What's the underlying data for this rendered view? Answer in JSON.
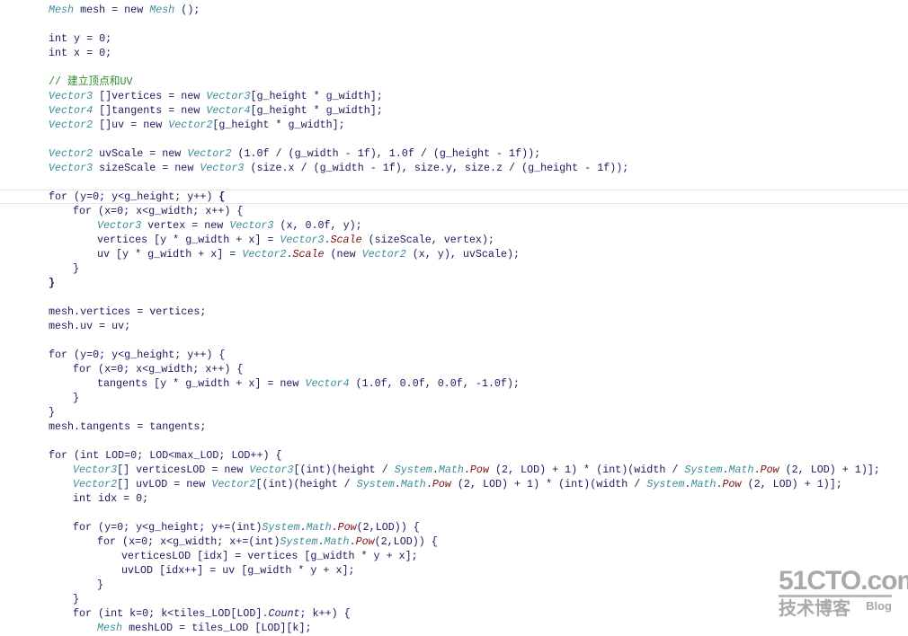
{
  "code": {
    "current_line": 13,
    "lines": [
      [
        [
          "t",
          "Mesh"
        ],
        [
          "k",
          " mesh = new "
        ],
        [
          "t",
          "Mesh"
        ],
        [
          "k",
          " ();"
        ]
      ],
      [],
      [
        [
          "k",
          "int y = 0;"
        ]
      ],
      [
        [
          "k",
          "int x = 0;"
        ]
      ],
      [],
      [
        [
          "c",
          "// 建立顶点和UV"
        ]
      ],
      [
        [
          "t",
          "Vector3"
        ],
        [
          "k",
          " []vertices = new "
        ],
        [
          "t",
          "Vector3"
        ],
        [
          "k",
          "[g_height * g_width];"
        ]
      ],
      [
        [
          "t",
          "Vector4"
        ],
        [
          "k",
          " []tangents = new "
        ],
        [
          "t",
          "Vector4"
        ],
        [
          "k",
          "[g_height * g_width];"
        ]
      ],
      [
        [
          "t",
          "Vector2"
        ],
        [
          "k",
          " []uv = new "
        ],
        [
          "t",
          "Vector2"
        ],
        [
          "k",
          "[g_height * g_width];"
        ]
      ],
      [],
      [
        [
          "t",
          "Vector2"
        ],
        [
          "k",
          " uvScale = new "
        ],
        [
          "t",
          "Vector2"
        ],
        [
          "k",
          " (1.0f / (g_width - 1f), 1.0f / (g_height - 1f));"
        ]
      ],
      [
        [
          "t",
          "Vector3"
        ],
        [
          "k",
          " sizeScale = new "
        ],
        [
          "t",
          "Vector3"
        ],
        [
          "k",
          " (size.x / (g_width - 1f), size.y, size.z / (g_height - 1f));"
        ]
      ],
      [],
      [
        [
          "k",
          "for (y=0; y<g_height; y++) "
        ],
        [
          "b",
          "{"
        ]
      ],
      [
        [
          "k",
          "\tfor (x=0; x<g_width; x++) {"
        ]
      ],
      [
        [
          "k",
          "\t\t"
        ],
        [
          "t",
          "Vector3"
        ],
        [
          "k",
          " vertex = new "
        ],
        [
          "t",
          "Vector3"
        ],
        [
          "k",
          " (x, 0.0f, y);"
        ]
      ],
      [
        [
          "k",
          "\t\tvertices [y * g_width + x] = "
        ],
        [
          "t",
          "Vector3"
        ],
        [
          "k",
          "."
        ],
        [
          "m",
          "Scale"
        ],
        [
          "k",
          " (sizeScale, vertex);"
        ]
      ],
      [
        [
          "k",
          "\t\tuv [y * g_width + x] = "
        ],
        [
          "t",
          "Vector2"
        ],
        [
          "k",
          "."
        ],
        [
          "m",
          "Scale"
        ],
        [
          "k",
          " (new "
        ],
        [
          "t",
          "Vector2"
        ],
        [
          "k",
          " (x, y), uvScale);"
        ]
      ],
      [
        [
          "k",
          "\t}"
        ]
      ],
      [
        [
          "b",
          "}"
        ]
      ],
      [],
      [
        [
          "k",
          "mesh.vertices = vertices;"
        ]
      ],
      [
        [
          "k",
          "mesh.uv = uv;"
        ]
      ],
      [],
      [
        [
          "k",
          "for (y=0; y<g_height; y++) {"
        ]
      ],
      [
        [
          "k",
          "\tfor (x=0; x<g_width; x++) {"
        ]
      ],
      [
        [
          "k",
          "\t\ttangents [y * g_width + x] = new "
        ],
        [
          "t",
          "Vector4"
        ],
        [
          "k",
          " (1.0f, 0.0f, 0.0f, -1.0f);"
        ]
      ],
      [
        [
          "k",
          "\t}"
        ]
      ],
      [
        [
          "k",
          "}"
        ]
      ],
      [
        [
          "k",
          "mesh.tangents = tangents;"
        ]
      ],
      [],
      [
        [
          "k",
          "for (int LOD=0; LOD<max_LOD; LOD++) {"
        ]
      ],
      [
        [
          "k",
          "\t"
        ],
        [
          "t",
          "Vector3"
        ],
        [
          "k",
          "[] verticesLOD = new "
        ],
        [
          "t",
          "Vector3"
        ],
        [
          "k",
          "[(int)(height / "
        ],
        [
          "t",
          "System"
        ],
        [
          "k",
          "."
        ],
        [
          "t",
          "Math"
        ],
        [
          "k",
          "."
        ],
        [
          "m",
          "Pow"
        ],
        [
          "k",
          " (2, LOD) + 1) * (int)(width / "
        ],
        [
          "t",
          "System"
        ],
        [
          "k",
          "."
        ],
        [
          "t",
          "Math"
        ],
        [
          "k",
          "."
        ],
        [
          "m",
          "Pow"
        ],
        [
          "k",
          " (2, LOD) + 1)];"
        ]
      ],
      [
        [
          "k",
          "\t"
        ],
        [
          "t",
          "Vector2"
        ],
        [
          "k",
          "[] uvLOD = new "
        ],
        [
          "t",
          "Vector2"
        ],
        [
          "k",
          "[(int)(height / "
        ],
        [
          "t",
          "System"
        ],
        [
          "k",
          "."
        ],
        [
          "t",
          "Math"
        ],
        [
          "k",
          "."
        ],
        [
          "m",
          "Pow"
        ],
        [
          "k",
          " (2, LOD) + 1) * (int)(width / "
        ],
        [
          "t",
          "System"
        ],
        [
          "k",
          "."
        ],
        [
          "t",
          "Math"
        ],
        [
          "k",
          "."
        ],
        [
          "m",
          "Pow"
        ],
        [
          "k",
          " (2, LOD) + 1)];"
        ]
      ],
      [
        [
          "k",
          "\tint idx = 0;"
        ]
      ],
      [],
      [
        [
          "k",
          "\tfor (y=0; y<g_height; y+=(int)"
        ],
        [
          "t",
          "System"
        ],
        [
          "k",
          "."
        ],
        [
          "t",
          "Math"
        ],
        [
          "k",
          "."
        ],
        [
          "m",
          "Pow"
        ],
        [
          "k",
          "(2,LOD)) {"
        ]
      ],
      [
        [
          "k",
          "\t\tfor (x=0; x<g_width; x+=(int)"
        ],
        [
          "t",
          "System"
        ],
        [
          "k",
          "."
        ],
        [
          "t",
          "Math"
        ],
        [
          "k",
          "."
        ],
        [
          "m",
          "Pow"
        ],
        [
          "k",
          "(2,LOD)) {"
        ]
      ],
      [
        [
          "k",
          "\t\t\tverticesLOD [idx] = vertices [g_width * y + x];"
        ]
      ],
      [
        [
          "k",
          "\t\t\tuvLOD [idx++] = uv [g_width * y + x];"
        ]
      ],
      [
        [
          "k",
          "\t\t}"
        ]
      ],
      [
        [
          "k",
          "\t}"
        ]
      ],
      [
        [
          "k",
          "\tfor (int k=0; k<tiles_LOD[LOD]."
        ],
        [
          "i",
          "Count"
        ],
        [
          "k",
          "; k++) {"
        ]
      ],
      [
        [
          "k",
          "\t\t"
        ],
        [
          "t",
          "Mesh"
        ],
        [
          "k",
          " meshLOD = tiles_LOD [LOD][k];"
        ]
      ]
    ]
  },
  "watermark": {
    "logo": "51CTO.com",
    "subtitle": "技术博客",
    "blog": "Blog"
  },
  "colors": {
    "type": "#3a8c9a",
    "method": "#7a1010",
    "comment": "#2e8b2e",
    "text": "#1a1a5e"
  }
}
